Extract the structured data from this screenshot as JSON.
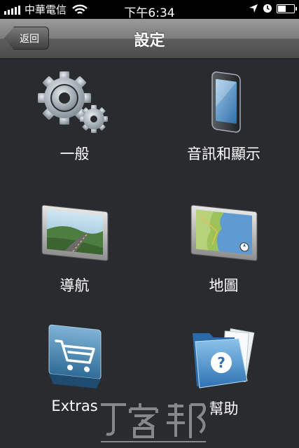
{
  "status": {
    "carrier": "中華電信",
    "time": "下午6:34",
    "battery_level": 0.55
  },
  "nav": {
    "back_label": "返回",
    "title": "設定"
  },
  "menu": [
    {
      "label": "一般",
      "icon": "gears-icon"
    },
    {
      "label": "音訊和顯示",
      "icon": "phone-icon"
    },
    {
      "label": "導航",
      "icon": "road-map-icon"
    },
    {
      "label": "地圖",
      "icon": "map-icon"
    },
    {
      "label": "Extras",
      "icon": "shopping-cart-icon"
    },
    {
      "label": "幫助",
      "icon": "help-folder-icon"
    }
  ],
  "colors": {
    "background": "#2a2b2e",
    "nav_gradient_top": "#9a9a9a",
    "nav_gradient_bottom": "#4b4b4b"
  }
}
